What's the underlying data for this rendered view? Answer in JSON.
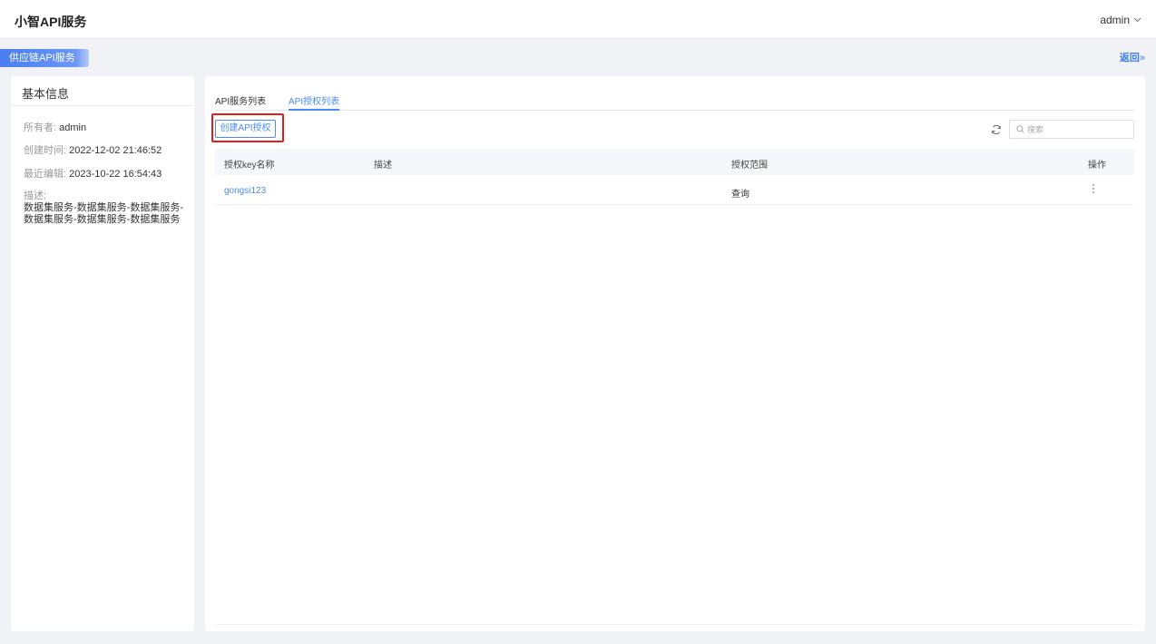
{
  "header": {
    "app_title": "小智API服务",
    "user_name": "admin",
    "user_chevron_icon": "chevron-down-icon"
  },
  "breadcrumb": {
    "tag_label": "供应链API服务",
    "back_label": "返回",
    "back_arrow": "»"
  },
  "info_panel": {
    "title": "基本信息",
    "owner_label": "所有者:",
    "owner_value": "admin",
    "created_label": "创建时间:",
    "created_value": "2022-12-02 21:46:52",
    "edited_label": "最近编辑:",
    "edited_value": "2023-10-22 16:54:43",
    "desc_label": "描述:",
    "desc_value": "数据集服务-数据集服务-数据集服务-数据集服务-数据集服务-数据集服务"
  },
  "tabs": [
    {
      "label": "API服务列表",
      "active": false
    },
    {
      "label": "API授权列表",
      "active": true
    }
  ],
  "toolbar": {
    "create_label": "创建API授权",
    "refresh_icon": "refresh-icon",
    "search_placeholder": "搜索",
    "search_value": ""
  },
  "table": {
    "columns": [
      "授权key名称",
      "描述",
      "授权范围",
      "操作"
    ],
    "rows": [
      {
        "name": "gongsi123",
        "desc": "",
        "scope": "查询",
        "action_icon": "more-vertical-icon"
      }
    ]
  },
  "colors": {
    "accent": "#4a8bf5",
    "highlight": "#e02020",
    "background": "#f0f2f5"
  }
}
